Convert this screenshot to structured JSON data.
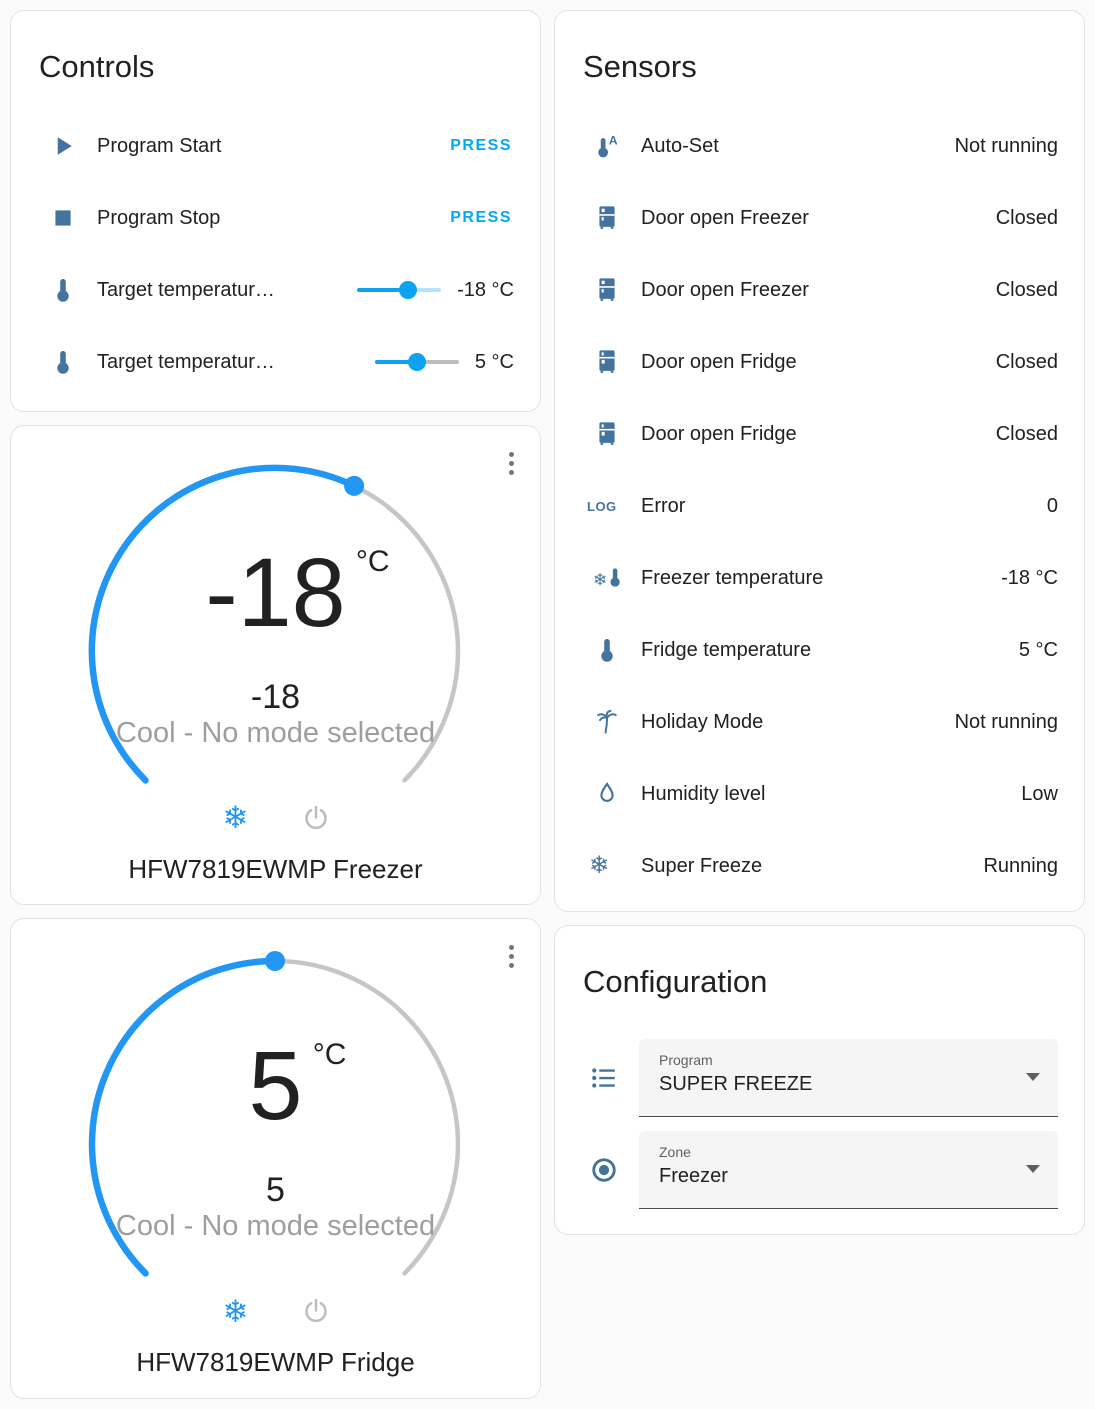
{
  "colors": {
    "icon_steel_blue": "#44739e",
    "accent_blue": "#2196f3",
    "press_blue": "#03a9f4",
    "slider_blue": "#0da2f2",
    "text_primary": "#212121",
    "text_secondary": "#9e9e9e"
  },
  "controls": {
    "title": "Controls",
    "rows": [
      {
        "icon": "play-icon",
        "label": "Program Start",
        "action": "PRESS"
      },
      {
        "icon": "stop-icon",
        "label": "Program Stop",
        "action": "PRESS"
      },
      {
        "icon": "thermometer-icon",
        "label": "Target temperatur…",
        "value": "-18 °C",
        "percent": 61
      },
      {
        "icon": "thermometer-icon",
        "label": "Target temperatur…",
        "value": "5 °C",
        "percent": 50
      }
    ]
  },
  "sensors": {
    "title": "Sensors",
    "rows": [
      {
        "icon": "thermometer-auto-icon",
        "label": "Auto-Set",
        "value": "Not running"
      },
      {
        "icon": "fridge-top-icon",
        "label": "Door open Freezer",
        "value": "Closed"
      },
      {
        "icon": "fridge-top-icon",
        "label": "Door open Freezer",
        "value": "Closed"
      },
      {
        "icon": "fridge-bottom-icon",
        "label": "Door open Fridge",
        "value": "Closed"
      },
      {
        "icon": "fridge-bottom-icon",
        "label": "Door open Fridge",
        "value": "Closed"
      },
      {
        "icon": "log-icon",
        "label": "Error",
        "value": "0"
      },
      {
        "icon": "snowflake-thermometer-icon",
        "label": "Freezer temperature",
        "value": "-18 °C"
      },
      {
        "icon": "thermometer-icon",
        "label": "Fridge temperature",
        "value": "5 °C"
      },
      {
        "icon": "palm-tree-icon",
        "label": "Holiday Mode",
        "value": "Not running"
      },
      {
        "icon": "water-drop-icon",
        "label": "Humidity level",
        "value": "Low"
      },
      {
        "icon": "snowflake-icon",
        "label": "Super Freeze",
        "value": "Running"
      }
    ]
  },
  "icons": {
    "log_glyph": "LOG",
    "snowflake_glyph": "❄"
  },
  "freezer": {
    "target": "-18",
    "unit": "°C",
    "current": "-18",
    "status": "Cool - No mode selected",
    "name": "HFW7819EWMP Freezer"
  },
  "fridge": {
    "target": "5",
    "unit": "°C",
    "current": "5",
    "status": "Cool - No mode selected",
    "name": "HFW7819EWMP Fridge"
  },
  "configuration": {
    "title": "Configuration",
    "fields": [
      {
        "icon": "list-icon",
        "label": "Program",
        "value": "SUPER FREEZE"
      },
      {
        "icon": "radiobox-icon",
        "label": "Zone",
        "value": "Freezer"
      }
    ]
  }
}
